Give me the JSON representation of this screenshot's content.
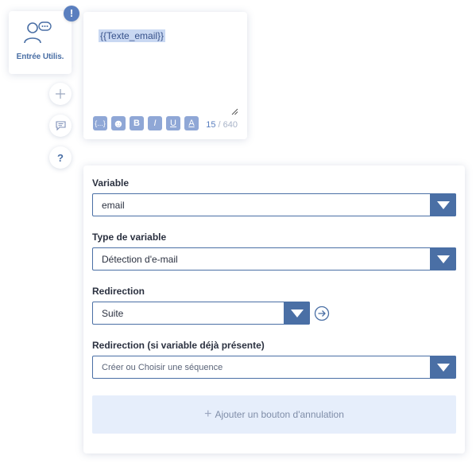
{
  "node": {
    "label": "Entrée Utilis.",
    "icon": "user-message-icon",
    "alert": "!"
  },
  "side_actions": {
    "add_icon": "plus-icon",
    "comment_icon": "comment-icon",
    "help_label": "?"
  },
  "message": {
    "text": "{{Texte_email}}",
    "counter_current": "15",
    "counter_sep": " / ",
    "counter_max": "640",
    "toolbar": [
      {
        "name": "variable-button",
        "icon": "braces-icon",
        "label": "{...}"
      },
      {
        "name": "emoji-button",
        "icon": "smiley-icon",
        "label": "☻"
      },
      {
        "name": "bold-button",
        "icon": "bold-icon",
        "label": "B"
      },
      {
        "name": "italic-button",
        "icon": "italic-icon",
        "label": "I"
      },
      {
        "name": "underline-button",
        "icon": "underline-icon",
        "label": "U"
      },
      {
        "name": "color-button",
        "icon": "text-color-icon",
        "label": "A"
      }
    ]
  },
  "form": {
    "variable_label": "Variable",
    "variable_value": "email",
    "type_label": "Type de variable",
    "type_value": "Détection d'e-mail",
    "redirection_label": "Redirection",
    "redirection_value": "Suite",
    "redirection2_label": "Redirection (si variable déjà présente)",
    "redirection2_placeholder": "Créer ou Choisir une séquence",
    "cancel_button_label": "Ajouter un bouton d'annulation"
  },
  "colors": {
    "accent": "#4a6fa5",
    "toolbar_button": "#8fa7d6",
    "cancel_bg": "#e6eefb"
  }
}
